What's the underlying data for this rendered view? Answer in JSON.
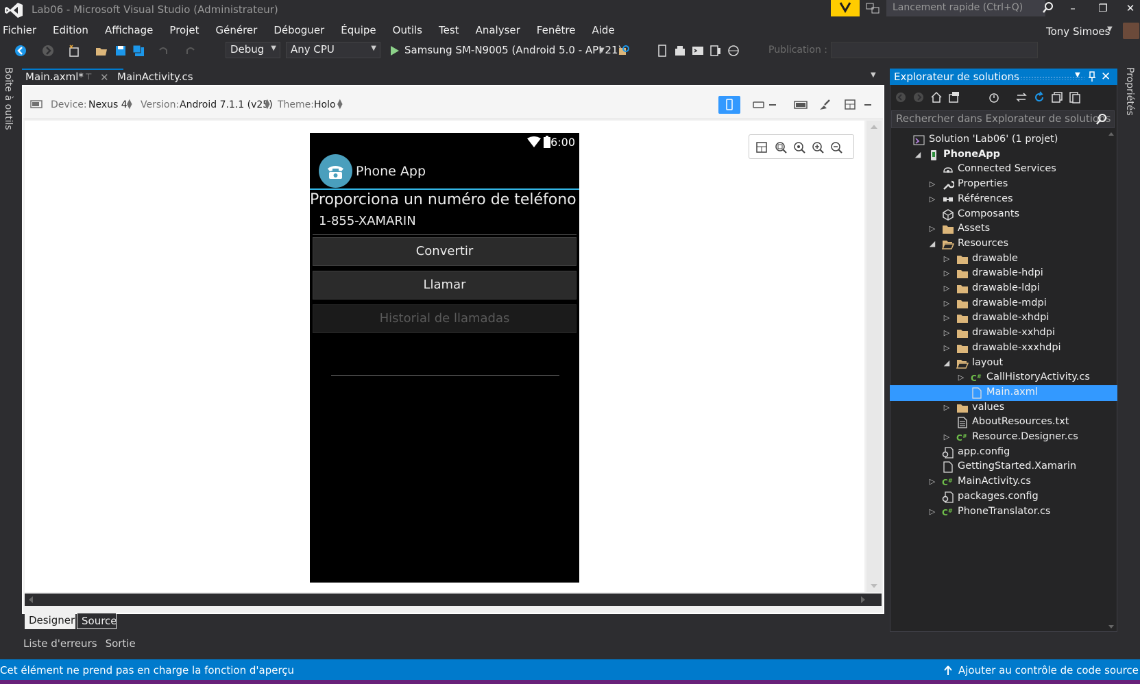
{
  "window": {
    "title": "Lab06 - Microsoft Visual Studio  (Administrateur)",
    "quick_launch_placeholder": "Lancement rapide (Ctrl+Q)",
    "user": "Tony Simoes"
  },
  "menu": [
    "Fichier",
    "Edition",
    "Affichage",
    "Projet",
    "Générer",
    "Déboguer",
    "Équipe",
    "Outils",
    "Test",
    "Analyser",
    "Fenêtre",
    "Aide"
  ],
  "toolbar": {
    "configuration": "Debug",
    "platform": "Any CPU",
    "run_target": "Samsung SM-N9005 (Android 5.0 - API 21)",
    "publish_label": "Publication :"
  },
  "side_labels": {
    "toolbox": "Boîte à outils",
    "properties": "Propriétés"
  },
  "tabs": [
    {
      "label": "Main.axml*",
      "active": true
    },
    {
      "label": "MainActivity.cs",
      "active": false
    }
  ],
  "designer": {
    "device_label": "Device:",
    "device": "Nexus 4",
    "version_label": "Version:",
    "version": "Android 7.1.1 (v25)",
    "theme_label": "Theme:",
    "theme": "Holo",
    "view_tabs": [
      "Designer",
      "Source"
    ]
  },
  "phone": {
    "time": "6:00",
    "app_title": "Phone App",
    "prompt": "Proporciona un numéro de teléfono",
    "input_value": "1-855-XAMARIN",
    "buttons": [
      {
        "label": "Convertir",
        "enabled": true
      },
      {
        "label": "Llamar",
        "enabled": true
      },
      {
        "label": "Historial de llamadas",
        "enabled": false
      }
    ]
  },
  "solution_explorer": {
    "title": "Explorateur de solutions",
    "search_placeholder": "Rechercher dans Explorateur de solutions (",
    "items": [
      {
        "label": "Solution 'Lab06' (1 projet)",
        "icon": "solution-icon",
        "expander": ""
      },
      {
        "label": "PhoneApp",
        "icon": "project-icon",
        "expander": "expanded",
        "bold": true
      },
      {
        "label": "Connected Services",
        "icon": "connected-services-icon",
        "expander": ""
      },
      {
        "label": "Properties",
        "icon": "wrench-icon",
        "expander": "collapsed"
      },
      {
        "label": "Références",
        "icon": "references-icon",
        "expander": "collapsed"
      },
      {
        "label": "Composants",
        "icon": "components-icon",
        "expander": ""
      },
      {
        "label": "Assets",
        "icon": "folder-icon",
        "expander": "collapsed"
      },
      {
        "label": "Resources",
        "icon": "folder-open-icon",
        "expander": "expanded"
      },
      {
        "label": "drawable",
        "icon": "folder-icon",
        "expander": "collapsed"
      },
      {
        "label": "drawable-hdpi",
        "icon": "folder-icon",
        "expander": "collapsed"
      },
      {
        "label": "drawable-ldpi",
        "icon": "folder-icon",
        "expander": "collapsed"
      },
      {
        "label": "drawable-mdpi",
        "icon": "folder-icon",
        "expander": "collapsed"
      },
      {
        "label": "drawable-xhdpi",
        "icon": "folder-icon",
        "expander": "collapsed"
      },
      {
        "label": "drawable-xxhdpi",
        "icon": "folder-icon",
        "expander": "collapsed"
      },
      {
        "label": "drawable-xxxhdpi",
        "icon": "folder-icon",
        "expander": "collapsed"
      },
      {
        "label": "layout",
        "icon": "folder-open-icon",
        "expander": "expanded"
      },
      {
        "label": "CallHistoryActivity.cs",
        "icon": "csharp-icon",
        "expander": "collapsed"
      },
      {
        "label": "Main.axml",
        "icon": "file-icon",
        "expander": "",
        "selected": true
      },
      {
        "label": "values",
        "icon": "folder-icon",
        "expander": "collapsed"
      },
      {
        "label": "AboutResources.txt",
        "icon": "text-file-icon",
        "expander": ""
      },
      {
        "label": "Resource.Designer.cs",
        "icon": "csharp-icon",
        "expander": "collapsed"
      },
      {
        "label": "app.config",
        "icon": "config-icon",
        "expander": ""
      },
      {
        "label": "GettingStarted.Xamarin",
        "icon": "file-icon",
        "expander": ""
      },
      {
        "label": "MainActivity.cs",
        "icon": "csharp-icon",
        "expander": "collapsed"
      },
      {
        "label": "packages.config",
        "icon": "config-icon",
        "expander": ""
      },
      {
        "label": "PhoneTranslator.cs",
        "icon": "csharp-icon",
        "expander": "collapsed"
      }
    ]
  },
  "bottom_tabs": [
    "Liste d'erreurs",
    "Sortie"
  ],
  "status": {
    "message": "Cet élément ne prend pas en charge la fonction d'aperçu",
    "source_control": "Ajouter au contrôle de code source"
  },
  "colors": {
    "accent": "#007acc",
    "selection": "#3399ff",
    "holo_blue": "#33b5e5",
    "vs_purple": "#68217a"
  }
}
